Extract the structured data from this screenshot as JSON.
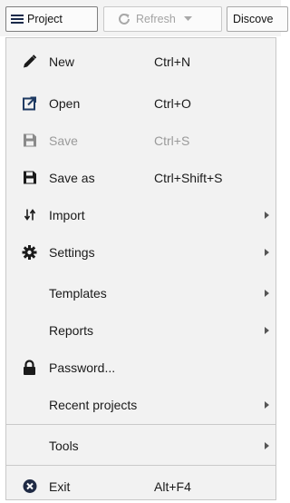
{
  "toolbar": {
    "project_label": "Project",
    "refresh_label": "Refresh",
    "discover_label": "Discove"
  },
  "menu": {
    "items": [
      {
        "label": "New",
        "shortcut": "Ctrl+N",
        "icon": "pencil-icon",
        "enabled": true
      },
      {
        "label": "Open",
        "shortcut": "Ctrl+O",
        "icon": "open-external-icon",
        "enabled": true
      },
      {
        "label": "Save",
        "shortcut": "Ctrl+S",
        "icon": "floppy-disk-icon",
        "enabled": false
      },
      {
        "label": "Save as",
        "shortcut": "Ctrl+Shift+S",
        "icon": "floppy-disk-icon",
        "enabled": true
      },
      {
        "label": "Import",
        "shortcut": "",
        "icon": "import-arrows-icon",
        "enabled": true,
        "submenu": true
      },
      {
        "label": "Settings",
        "shortcut": "",
        "icon": "gear-icon",
        "enabled": true,
        "submenu": true
      },
      {
        "label": "Templates",
        "shortcut": "",
        "icon": "",
        "enabled": true,
        "submenu": true
      },
      {
        "label": "Reports",
        "shortcut": "",
        "icon": "",
        "enabled": true,
        "submenu": true
      },
      {
        "label": "Password...",
        "shortcut": "",
        "icon": "lock-icon",
        "enabled": true
      },
      {
        "label": "Recent projects",
        "shortcut": "",
        "icon": "",
        "enabled": true,
        "submenu": true
      },
      {
        "label": "Tools",
        "shortcut": "",
        "icon": "",
        "enabled": true,
        "submenu": true
      },
      {
        "label": "Exit",
        "shortcut": "Alt+F4",
        "icon": "close-circle-icon",
        "enabled": true
      }
    ]
  },
  "colors": {
    "icon": "#1a1a1a",
    "disabled_icon": "#8a8a8a",
    "open_icon": "#1f3b63"
  }
}
